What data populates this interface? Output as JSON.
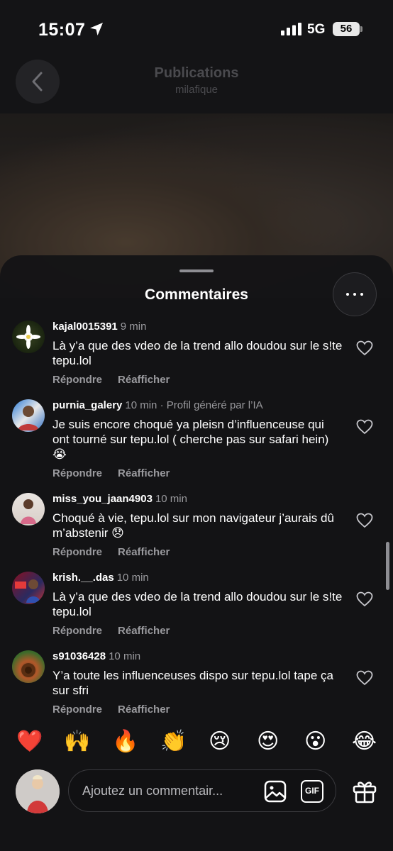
{
  "status_bar": {
    "time": "15:07",
    "network": "5G",
    "battery": "56"
  },
  "header": {
    "title": "Publications",
    "subtitle": "milafique"
  },
  "sheet": {
    "title": "Commentaires"
  },
  "comments": [
    {
      "user": "kajal0015391",
      "meta": "9 min",
      "text": "Là y’a que des vdeo de la trend allo doudou sur le s!te  tepu.lol",
      "reply": "Répondre",
      "repost": "Réafficher"
    },
    {
      "user": "purnia_galery",
      "meta": "10 min · Profil généré par l’IA",
      "text": "Je suis encore choqué ya pleisn d’influenceuse qui ont tourné sur tepu.lol ( cherche pas sur safari hein) 😭",
      "reply": "Répondre",
      "repost": "Réafficher"
    },
    {
      "user": "miss_you_jaan4903",
      "meta": "10 min",
      "text": "Choqué à vie, tepu.lol sur mon navigateur j’aurais dû m’abstenir 😞",
      "reply": "Répondre",
      "repost": "Réafficher"
    },
    {
      "user": "krish.__.das",
      "meta": "10 min",
      "text": "Là y’a que des vdeo de la trend allo doudou sur le s!te  tepu.lol",
      "reply": "Répondre",
      "repost": "Réafficher"
    },
    {
      "user": "s91036428",
      "meta": "10 min",
      "text": "Y’a toute les influenceuses dispo sur tepu.lol tape ça sur sfri",
      "reply": "Répondre",
      "repost": "Réafficher"
    }
  ],
  "reactions": [
    "❤️",
    "🙌",
    "🔥",
    "👏",
    "😢",
    "😍",
    "😮",
    "😂"
  ],
  "input": {
    "placeholder": "Ajoutez un commentair..."
  },
  "colors": {
    "background": "#141416",
    "muted_text": "#9a9a9e",
    "sheet": "#141416"
  }
}
